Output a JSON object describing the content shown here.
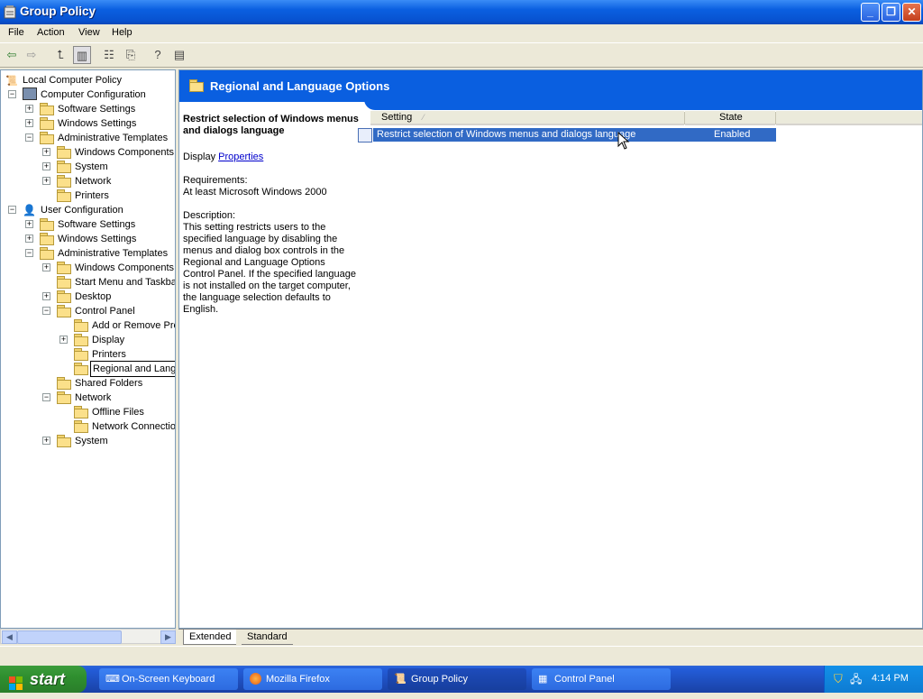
{
  "window": {
    "title": "Group Policy"
  },
  "menu": [
    "File",
    "Action",
    "View",
    "Help"
  ],
  "tree": {
    "root": "Local Computer Policy",
    "computer_config": "Computer Configuration",
    "cc_items": [
      "Software Settings",
      "Windows Settings",
      "Administrative Templates"
    ],
    "cc_admin_items": [
      "Windows Components",
      "System",
      "Network",
      "Printers"
    ],
    "user_config": "User Configuration",
    "uc_items": [
      "Software Settings",
      "Windows Settings",
      "Administrative Templates"
    ],
    "uc_admin_items": [
      "Windows Components",
      "Start Menu and Taskba",
      "Desktop",
      "Control Panel"
    ],
    "control_panel_items": [
      "Add or Remove Prc",
      "Display",
      "Printers",
      "Regional and Language Options"
    ],
    "after_cp": [
      "Shared Folders",
      "Network"
    ],
    "network_items": [
      "Offline Files",
      "Network Connectio"
    ],
    "last": "System"
  },
  "banner": {
    "title": "Regional and Language Options"
  },
  "description": {
    "title": "Restrict selection of Windows menus and dialogs language",
    "display_prefix": "Display",
    "properties_link": "Properties",
    "requirements_label": "Requirements:",
    "requirements": "At least Microsoft Windows 2000",
    "description_label": "Description:",
    "text": "This setting restricts users to the specified language by disabling the menus and dialog box controls in the Regional and Language Options Control Panel. If the specified language is not installed on the target computer, the language selection defaults to English."
  },
  "list": {
    "columns": [
      "Setting",
      "State"
    ],
    "rows": [
      {
        "setting": "Restrict selection of Windows menus and dialogs language",
        "state": "Enabled"
      }
    ]
  },
  "tabs": [
    "Extended",
    "Standard"
  ],
  "taskbar": {
    "start": "start",
    "buttons": [
      "On-Screen Keyboard",
      "Mozilla Firefox",
      "Group Policy",
      "Control Panel"
    ],
    "clock": "4:14 PM"
  },
  "colors": {
    "title_blue": "#0a5fe0",
    "selection": "#316ac5",
    "start_green": "#2f8f2f"
  }
}
